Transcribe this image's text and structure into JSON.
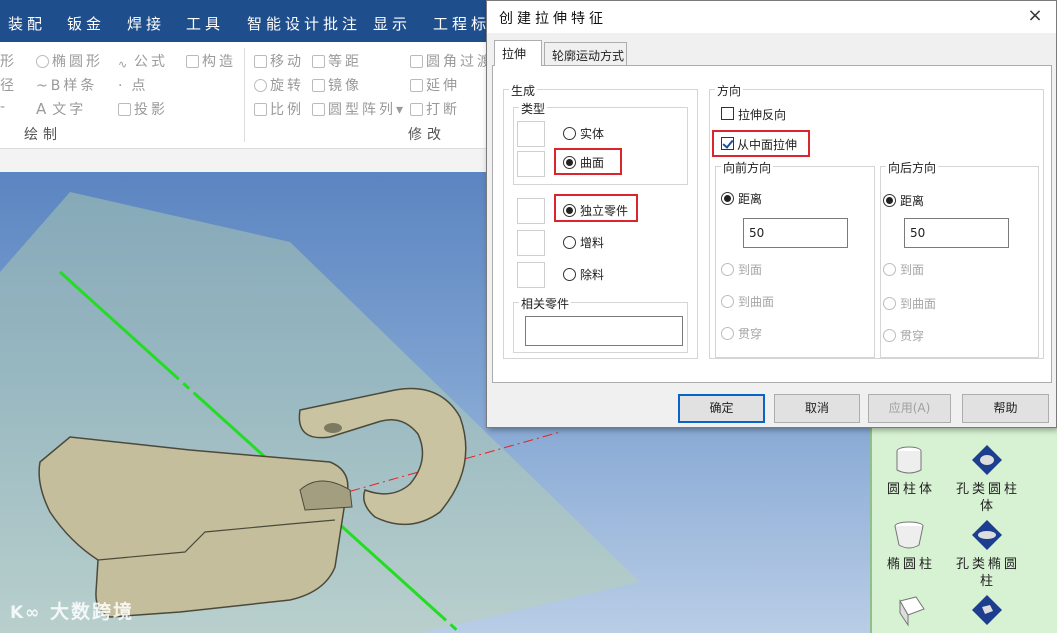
{
  "menu": [
    "装配",
    "钣金",
    "焊接",
    "工具",
    "智能设计批注",
    "显示",
    "工程标注"
  ],
  "ribbon": {
    "draw": {
      "col1": [
        "形",
        "径",
        ""
      ],
      "col2": [
        "椭圆形",
        "B样条",
        "文字"
      ],
      "col3": [
        "公式",
        "点",
        "投影"
      ],
      "col4": [
        "构造"
      ],
      "label": "绘制"
    },
    "modify": {
      "col1": [
        "移动",
        "旋转",
        "比例"
      ],
      "col2": [
        "等距",
        "镜像",
        "圆型阵列"
      ],
      "col3": [
        "圆角过渡",
        "延伸",
        "打断"
      ],
      "label": "修改"
    }
  },
  "dialog": {
    "title": "创建拉伸特征",
    "close": "×",
    "tabs": [
      "拉伸",
      "轮廓运动方式"
    ],
    "generate": {
      "title": "生成",
      "type_title": "类型",
      "type_options": [
        "实体",
        "曲面"
      ],
      "part_options": [
        "独立零件",
        "增料",
        "除料"
      ],
      "related_title": "相关零件",
      "related_value": ""
    },
    "direction": {
      "title": "方向",
      "reverse": "拉伸反向",
      "from_middle": "从中面拉伸",
      "forward": {
        "title": "向前方向",
        "options": [
          "距离",
          "到面",
          "到曲面",
          "贯穿"
        ],
        "distance": "50"
      },
      "backward": {
        "title": "向后方向",
        "options": [
          "距离",
          "到面",
          "到曲面",
          "贯穿"
        ],
        "distance": "50"
      }
    },
    "buttons": {
      "ok": "确定",
      "cancel": "取消",
      "apply": "应用(A)",
      "help": "帮助"
    }
  },
  "tools": [
    {
      "label": "圆柱体"
    },
    {
      "label": "孔类圆柱体"
    },
    {
      "label": "椭圆柱"
    },
    {
      "label": "孔类椭圆柱"
    }
  ],
  "watermark": "大数跨境",
  "colors": {
    "menubar": "#1f4e8c",
    "highlight": "#d9252b",
    "panel": "#d7f2d3"
  }
}
